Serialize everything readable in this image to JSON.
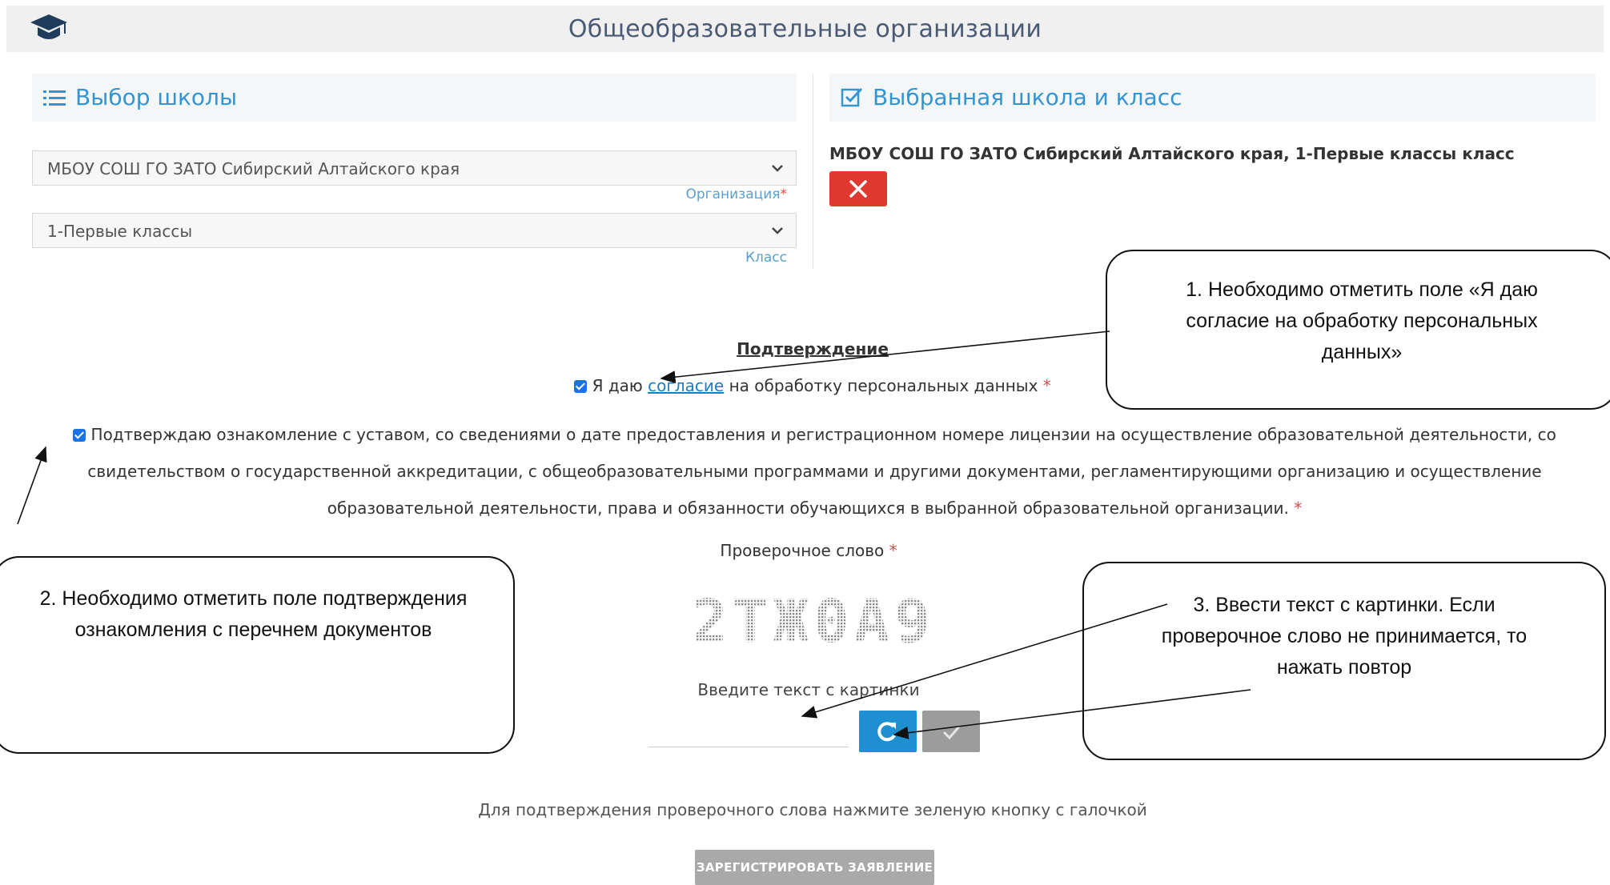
{
  "header": {
    "title": "Общеобразовательные организации",
    "logo_icon": "graduation-cap-icon"
  },
  "left_panel": {
    "title": "Выбор школы",
    "title_icon": "list-icon",
    "organization_select": {
      "value": "МБОУ СОШ ГО ЗАТО Сибирский Алтайского края",
      "hint": "Организация"
    },
    "class_select": {
      "value": "1-Первые классы",
      "hint": "Класс"
    },
    "required_mark": "*"
  },
  "right_panel": {
    "title": "Выбранная школа и класс",
    "title_icon": "checkbox-icon",
    "selected_text": "МБОУ СОШ ГО ЗАТО Сибирский Алтайского края, 1-Первые классы класс",
    "remove_icon": "close-icon"
  },
  "confirmation": {
    "title": "Подтверждение",
    "consent_prefix": "Я даю",
    "consent_link": "согласие",
    "consent_suffix": "на обработку персональных данных",
    "consent_checked": true,
    "ack_text": "Подтверждаю ознакомление с уставом, со сведениями о дате предоставления и регистрационном номере лицензии на осуществление образовательной деятельности, со свидетельством о государственной аккредитации, с общеобразовательными программами и другими документами, регламентирующими организацию и осуществление образовательной деятельности, права и обязанности обучающихся в выбранной образовательной организации.",
    "ack_checked": true,
    "required_mark": "*"
  },
  "captcha": {
    "label": "Проверочное слово",
    "image_text": "2TЖ0A9",
    "input_hint": "Введите текст с картинки",
    "input_value": "",
    "refresh_icon": "refresh-icon",
    "check_icon": "check-icon"
  },
  "footer": {
    "hint": "Для подтверждения проверочного слова нажмите зеленую кнопку с галочкой",
    "submit_label": "ЗАРЕГИСТРИРОВАТЬ ЗАЯВЛЕНИЕ"
  },
  "callouts": [
    {
      "text": "1. Необходимо отметить поле «Я даю согласие на обработку персональных данных»"
    },
    {
      "text": "2. Необходимо отметить поле подтверждения ознакомления с перечнем документов"
    },
    {
      "text": "3. Ввести текст с картинки. Если проверочное слово не принимается, то нажать повтор"
    }
  ],
  "colors": {
    "accent": "#3396d2",
    "danger": "#e03a30",
    "refresh": "#1e8fd0",
    "disabled": "#a9a9a9",
    "header_bg": "#f0f0f0"
  }
}
